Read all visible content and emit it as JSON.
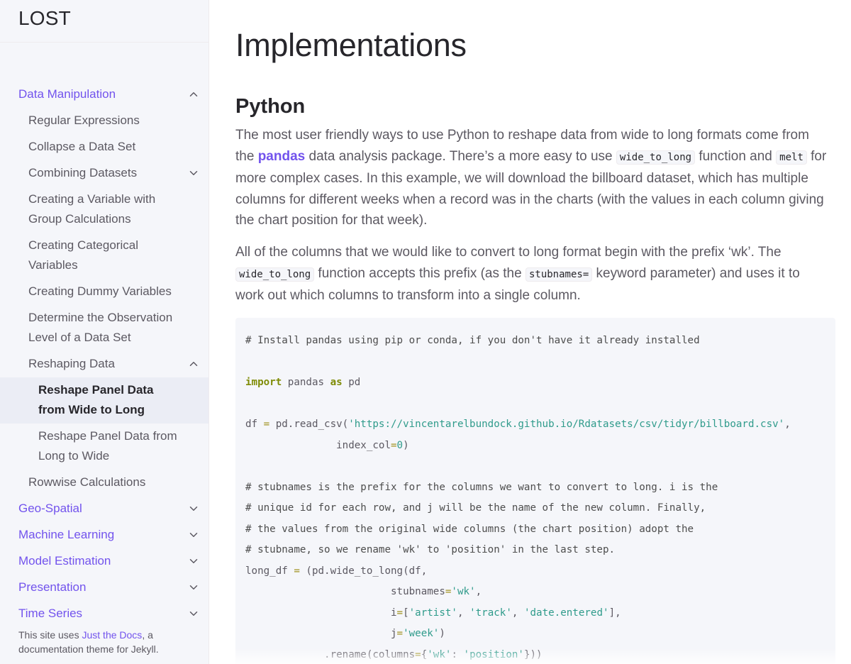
{
  "site": {
    "title": "LOST"
  },
  "sidebar": {
    "items": [
      {
        "label": "Data Manipulation",
        "level": 1,
        "chevron": "up"
      },
      {
        "label": "Regular Expressions",
        "level": 2
      },
      {
        "label": "Collapse a Data Set",
        "level": 2
      },
      {
        "label": "Combining Datasets",
        "level": 2,
        "chevron": "down"
      },
      {
        "label": "Creating a Variable with Group Calculations",
        "level": 2
      },
      {
        "label": "Creating Categorical Variables",
        "level": 2
      },
      {
        "label": "Creating Dummy Variables",
        "level": 2
      },
      {
        "label": "Determine the Observation Level of a Data Set",
        "level": 2
      },
      {
        "label": "Reshaping Data",
        "level": 2,
        "chevron": "up"
      },
      {
        "label": "Reshape Panel Data from Wide to Long",
        "level": 3,
        "active": true
      },
      {
        "label": "Reshape Panel Data from Long to Wide",
        "level": 3
      },
      {
        "label": "Rowwise Calculations",
        "level": 2
      },
      {
        "label": "Geo-Spatial",
        "level": 1,
        "chevron": "down"
      },
      {
        "label": "Machine Learning",
        "level": 1,
        "chevron": "down"
      },
      {
        "label": "Model Estimation",
        "level": 1,
        "chevron": "down"
      },
      {
        "label": "Presentation",
        "level": 1,
        "chevron": "down"
      },
      {
        "label": "Time Series",
        "level": 1,
        "chevron": "down"
      }
    ],
    "footer": {
      "prefix": "This site uses ",
      "link": "Just the Docs",
      "suffix": ", a documentation theme for Jekyll."
    }
  },
  "main": {
    "title": "Implementations",
    "section": "Python",
    "para1": {
      "t1": "The most user friendly ways to use Python to reshape data from wide to long formats come from the ",
      "link": "pandas",
      "t2": " data analysis package. There’s a more easy to use ",
      "code1": "wide_to_long",
      "t3": " function and ",
      "code2": "melt",
      "t4": " for more complex cases. In this example, we will download the billboard dataset, which has multiple columns for different weeks when a record was in the charts (with the values in each column giving the chart position for that week)."
    },
    "para2": {
      "t1": "All of the columns that we would like to convert to long format begin with the prefix ‘wk’. The ",
      "code1": "wide_to_long",
      "t2": " function accepts this prefix (as the ",
      "code2": "stubnames=",
      "t3": " keyword parameter) and uses it to work out which columns to transform into a single column."
    },
    "code": {
      "comment_install": "# Install pandas using pip or conda, if you don't have it already installed",
      "kw_import": "import",
      "mod_pandas": " pandas ",
      "kw_as": "as",
      "alias_pd": " pd",
      "df_var": "df",
      "eq": " = ",
      "read_csv_call": "pd.read_csv(",
      "csv_url": "'https://vincentarelbundock.github.io/Rdatasets/csv/tidyr/billboard.csv'",
      "comma": ",",
      "index_col_indent": "               index_col",
      "eq2": "=",
      "zero": "0",
      "close_paren": ")",
      "comment1": "# stubnames is the prefix for the columns we want to convert to long. i is the",
      "comment2": "# unique id for each row, and j will be the name of the new column. Finally,",
      "comment3": "# the values from the original wide columns (the chart position) adopt the",
      "comment4": "# stubname, so we rename 'wk' to 'position' in the last step.",
      "long_df_var": "long_df",
      "wtl_call": "(pd.wide_to_long(df,",
      "stub_indent": "                        stubnames",
      "wk_str": "'wk'",
      "i_indent": "                        i",
      "i_open": "[",
      "artist_str": "'artist'",
      "track_str": "'track'",
      "date_str": "'date.entered'",
      "i_close": "],",
      "j_indent": "                        j",
      "week_str": "'week'",
      "rename_indent": "             .rename(columns",
      "rename_open": "{",
      "wk_str2": "'wk'",
      "colon": ": ",
      "position_str": "'position'",
      "rename_close": "}))",
      "sep": ", "
    }
  }
}
